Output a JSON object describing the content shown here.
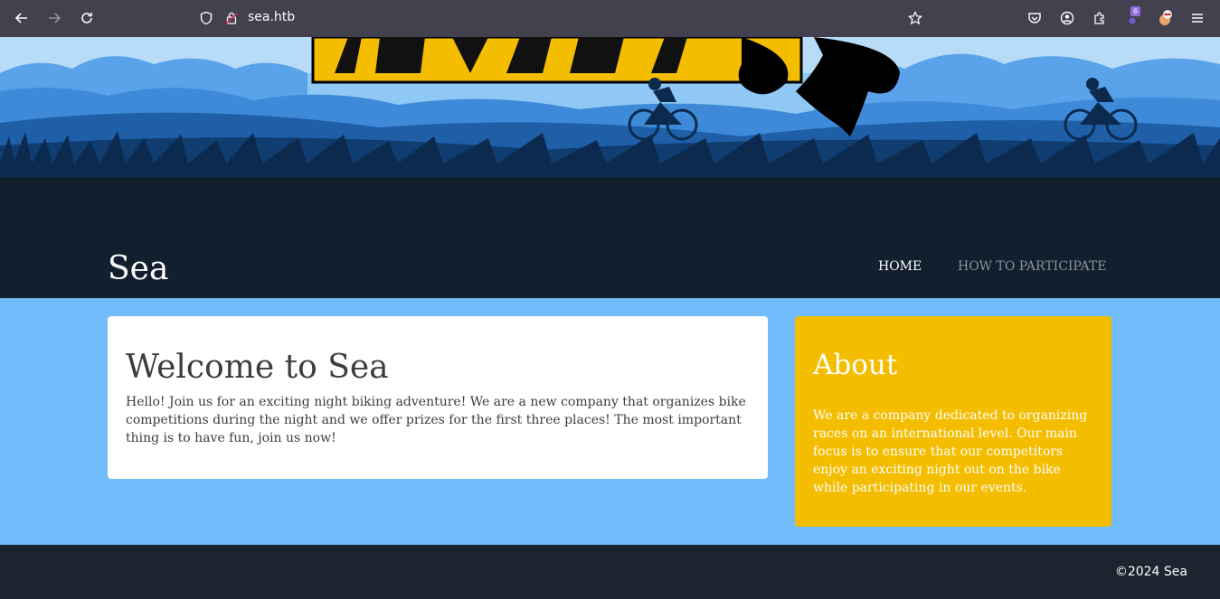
{
  "browser": {
    "url": "sea.htb",
    "extension_badge": "6"
  },
  "site": {
    "title": "Sea",
    "nav": {
      "home": "HOME",
      "how_to_participate": "HOW TO PARTICIPATE"
    }
  },
  "welcome": {
    "heading": "Welcome to Sea",
    "body": "Hello! Join us for an exciting night biking adventure! We are a new company that organizes bike competitions during the night and we offer prizes for the first three places! The most important thing is to have fun, join us now!"
  },
  "about": {
    "heading": "About",
    "body": "We are a company dedicated to organizing races on an international level. Our main focus is to ensure that our competitors enjoy an exciting night out on the bike while participating in our events."
  },
  "footer": {
    "copyright": "©2024 Sea"
  },
  "colors": {
    "chrome": "#42414d",
    "hero_dark": "#121f2e",
    "main_bg": "#72bcfb",
    "about_bg": "#f4bd00",
    "footer_bg": "#1b2530"
  }
}
